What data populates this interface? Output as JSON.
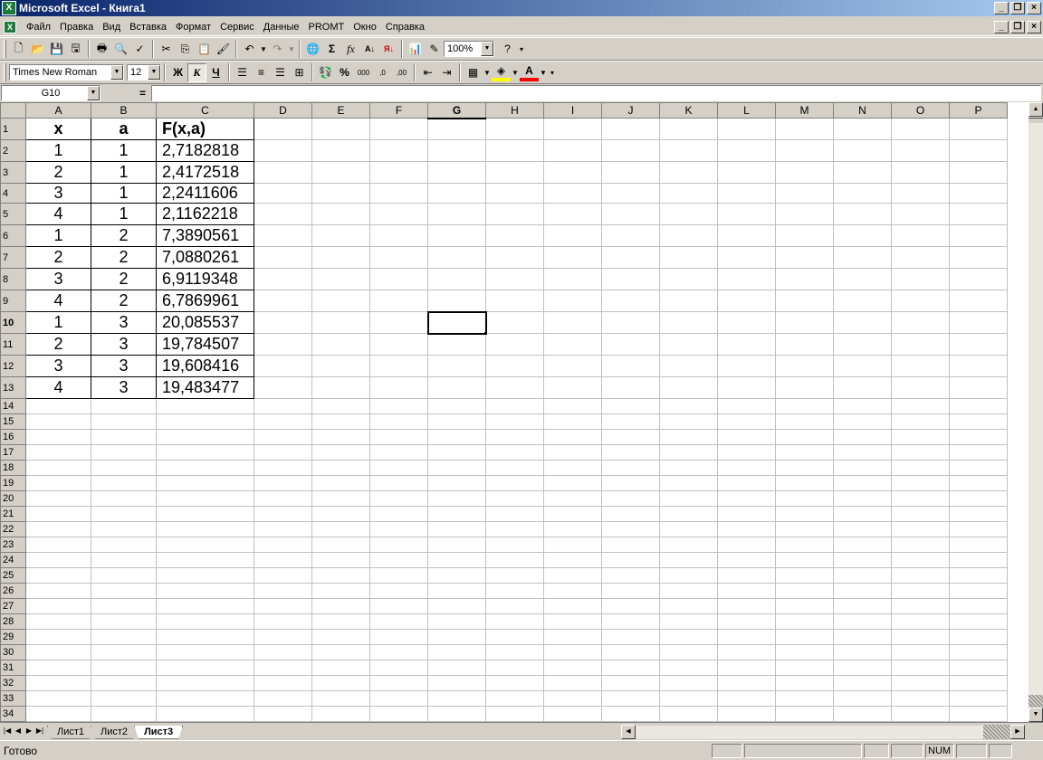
{
  "window": {
    "title": "Microsoft Excel - Книга1",
    "app_icon": "excel-icon"
  },
  "menu": {
    "items": [
      "Файл",
      "Правка",
      "Вид",
      "Вставка",
      "Формат",
      "Сервис",
      "Данные",
      "PROMT",
      "Окно",
      "Справка"
    ]
  },
  "standard_toolbar": {
    "zoom": "100%"
  },
  "format_toolbar": {
    "font_name": "Times New Roman",
    "font_size": "12",
    "bold_label": "Ж",
    "italic_label": "К",
    "underline_label": "Ч"
  },
  "formula_bar": {
    "name_box": "G10",
    "equals": "=",
    "content": ""
  },
  "sheet": {
    "columns": [
      "A",
      "B",
      "C",
      "D",
      "E",
      "F",
      "G",
      "H",
      "I",
      "J",
      "K",
      "L",
      "M",
      "N",
      "O",
      "P"
    ],
    "rows": [
      "1",
      "2",
      "3",
      "4",
      "5",
      "6",
      "7",
      "8",
      "9",
      "10",
      "11",
      "12",
      "13",
      "14",
      "15",
      "16",
      "17",
      "18",
      "19",
      "20",
      "21",
      "22",
      "23",
      "24",
      "25",
      "26",
      "27",
      "28",
      "29",
      "30",
      "31",
      "32",
      "33",
      "34"
    ],
    "active_cell": "G10",
    "headers": [
      "x",
      "a",
      "F(x,a)"
    ],
    "data": [
      [
        "1",
        "1",
        "2,7182818"
      ],
      [
        "2",
        "1",
        "2,4172518"
      ],
      [
        "3",
        "1",
        "2,2411606"
      ],
      [
        "4",
        "1",
        "2,1162218"
      ],
      [
        "1",
        "2",
        "7,3890561"
      ],
      [
        "2",
        "2",
        "7,0880261"
      ],
      [
        "3",
        "2",
        "6,9119348"
      ],
      [
        "4",
        "2",
        "6,7869961"
      ],
      [
        "1",
        "3",
        "20,085537"
      ],
      [
        "2",
        "3",
        "19,784507"
      ],
      [
        "3",
        "3",
        "19,608416"
      ],
      [
        "4",
        "3",
        "19,483477"
      ]
    ]
  },
  "sheet_tabs": [
    "Лист1",
    "Лист2",
    "Лист3"
  ],
  "active_tab": "Лист3",
  "status": {
    "text": "Готово",
    "num": "NUM"
  }
}
